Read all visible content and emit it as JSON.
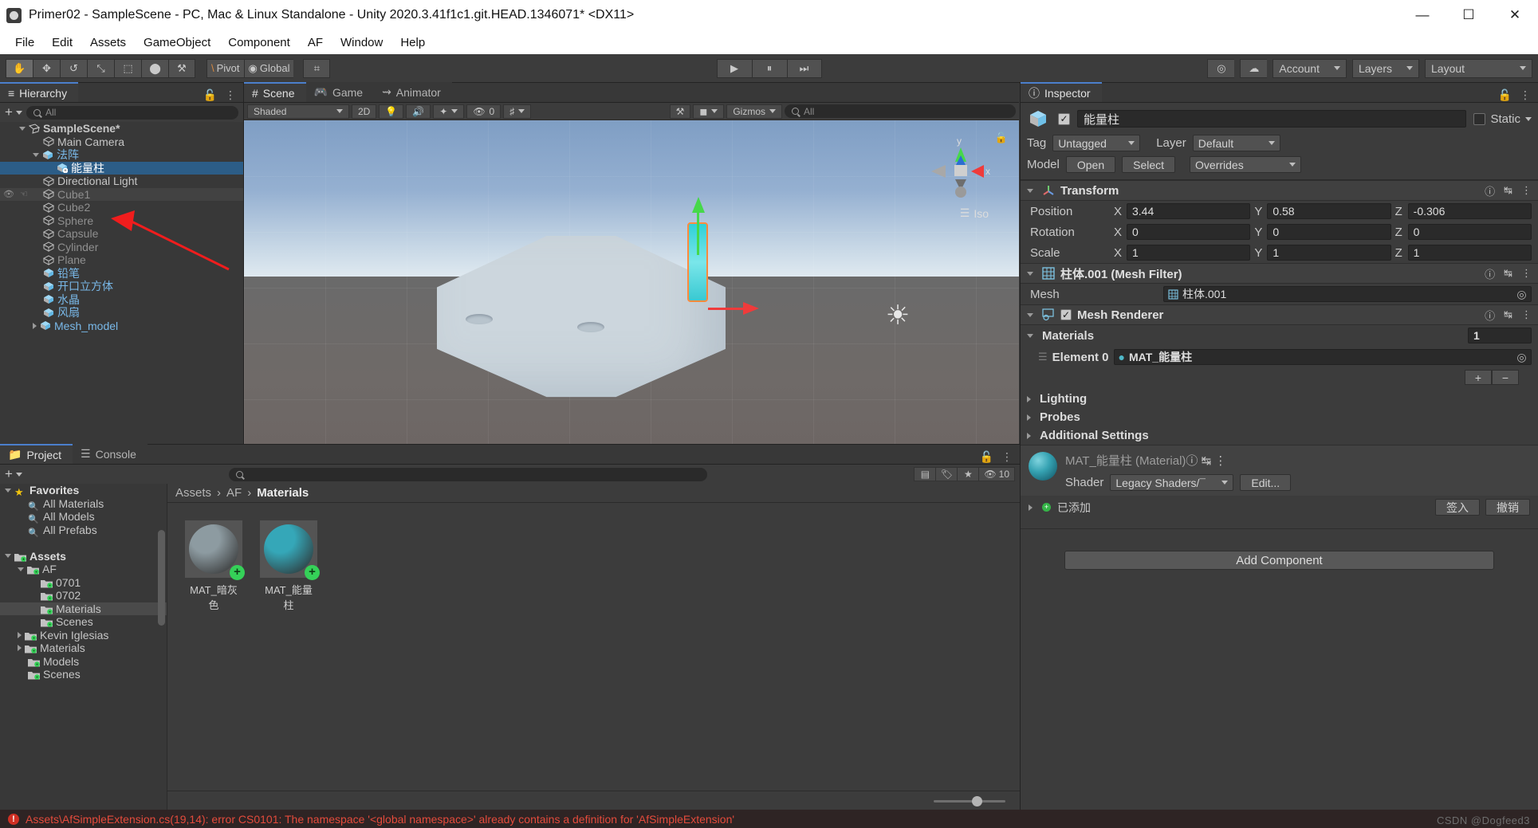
{
  "window": {
    "title": "Primer02 - SampleScene - PC, Mac & Linux Standalone - Unity 2020.3.41f1c1.git.HEAD.1346071* <DX11>",
    "minimize": "—",
    "maximize": "☐",
    "close": "✕"
  },
  "menubar": [
    "File",
    "Edit",
    "Assets",
    "GameObject",
    "Component",
    "AF",
    "Window",
    "Help"
  ],
  "toolbar": {
    "tools": [
      {
        "name": "hand-tool",
        "glyph": "✋"
      },
      {
        "name": "move-tool",
        "glyph": "✥"
      },
      {
        "name": "rotate-tool",
        "glyph": "↺"
      },
      {
        "name": "scale-tool",
        "glyph": "⤡"
      },
      {
        "name": "rect-tool",
        "glyph": "⬚"
      },
      {
        "name": "transform-tool",
        "glyph": "⬤"
      },
      {
        "name": "custom-tool",
        "glyph": "⚒"
      }
    ],
    "pivot_label": "Pivot",
    "global_label": "Global",
    "grid_glyph": "⌗",
    "play": "▶",
    "pause": "⏸",
    "step": "⏭",
    "collab_glyph": "☁",
    "services_glyph": "◎",
    "account": "Account",
    "layers": "Layers",
    "layout": "Layout"
  },
  "hierarchy": {
    "tab": "Hierarchy",
    "search_placeholder": "All",
    "items": [
      {
        "label": "SampleScene*",
        "depth": 0,
        "icon": "scene-icon",
        "arrow": "open",
        "bold": true,
        "state": "normal"
      },
      {
        "label": "Main Camera",
        "depth": 1,
        "icon": "gameobject-icon",
        "arrow": "none",
        "state": "normal"
      },
      {
        "label": "法阵",
        "depth": 1,
        "icon": "prefab-icon",
        "arrow": "open",
        "state": "prefab"
      },
      {
        "label": "能量柱",
        "depth": 2,
        "icon": "prefab-child-icon",
        "arrow": "none",
        "state": "selected"
      },
      {
        "label": "Directional Light",
        "depth": 1,
        "icon": "gameobject-icon",
        "arrow": "none",
        "state": "normal"
      },
      {
        "label": "Cube1",
        "depth": 1,
        "icon": "gameobject-icon",
        "arrow": "none",
        "state": "hidden-hover"
      },
      {
        "label": "Cube2",
        "depth": 1,
        "icon": "gameobject-icon",
        "arrow": "none",
        "state": "dim"
      },
      {
        "label": "Sphere",
        "depth": 1,
        "icon": "gameobject-icon",
        "arrow": "none",
        "state": "dim"
      },
      {
        "label": "Capsule",
        "depth": 1,
        "icon": "gameobject-icon",
        "arrow": "none",
        "state": "dim"
      },
      {
        "label": "Cylinder",
        "depth": 1,
        "icon": "gameobject-icon",
        "arrow": "none",
        "state": "dim"
      },
      {
        "label": "Plane",
        "depth": 1,
        "icon": "gameobject-icon",
        "arrow": "none",
        "state": "dim"
      },
      {
        "label": "铅笔",
        "depth": 1,
        "icon": "prefab-icon",
        "arrow": "none",
        "state": "prefab"
      },
      {
        "label": "开口立方体",
        "depth": 1,
        "icon": "prefab-icon",
        "arrow": "none",
        "state": "prefab"
      },
      {
        "label": "水晶",
        "depth": 1,
        "icon": "prefab-icon",
        "arrow": "none",
        "state": "prefab"
      },
      {
        "label": "风扇",
        "depth": 1,
        "icon": "prefab-icon",
        "arrow": "none",
        "state": "prefab"
      },
      {
        "label": "Mesh_model",
        "depth": 1,
        "icon": "prefab-icon",
        "arrow": "closed",
        "state": "prefab"
      }
    ]
  },
  "scene": {
    "tabs": [
      {
        "label": "Scene",
        "icon": "grid-icon",
        "active": true
      },
      {
        "label": "Game",
        "icon": "gamepad-icon",
        "active": false
      },
      {
        "label": "Animator",
        "icon": "animator-icon",
        "active": false
      }
    ],
    "shading": "Shaded",
    "mode_2d": "2D",
    "light_glyph": "Ὂ1",
    "audio_glyph": "ὐA",
    "fx_glyph": "✦",
    "hidden_count": "0",
    "grid_glyph": "⌗",
    "tool_glyph": "⚒",
    "camera_glyph": "■",
    "gizmos_label": "Gizmos",
    "gizmos_search_placeholder": "All",
    "view_mode": "Iso",
    "axis_x": "x",
    "axis_y": "y"
  },
  "inspector": {
    "tab": "Inspector",
    "object_name": "能量柱",
    "enabled": true,
    "static_label": "Static",
    "tag_label": "Tag",
    "tag_value": "Untagged",
    "layer_label": "Layer",
    "layer_value": "Default",
    "model_label": "Model",
    "open_button": "Open",
    "select_button": "Select",
    "overrides_button": "Overrides",
    "transform": {
      "title": "Transform",
      "rows": [
        {
          "name": "Position",
          "x": "3.44",
          "y": "0.58",
          "z": "-0.306"
        },
        {
          "name": "Rotation",
          "x": "0",
          "y": "0",
          "z": "0"
        },
        {
          "name": "Scale",
          "x": "1",
          "y": "1",
          "z": "1"
        }
      ]
    },
    "mesh_filter": {
      "title": "柱体.001 (Mesh Filter)",
      "mesh_label": "Mesh",
      "mesh_value": "柱体.001"
    },
    "mesh_renderer": {
      "title": "Mesh Renderer",
      "enabled": true,
      "materials_label": "Materials",
      "materials_count": "1",
      "element_label": "Element 0",
      "element_value": "MAT_能量柱",
      "plus": "+",
      "minus": "−",
      "sections": [
        "Lighting",
        "Probes",
        "Additional Settings"
      ]
    },
    "material_preview": {
      "title": "MAT_能量柱 (Material)",
      "shader_label": "Shader",
      "shader_value": "Legacy Shaders/¯",
      "edit_button": "Edit..."
    },
    "vcs": {
      "status": "已添加",
      "checkin_button": "签入",
      "revert_button": "撤销"
    },
    "add_component": "Add Component"
  },
  "project": {
    "tabs": [
      {
        "label": "Project",
        "icon": "folder-icon",
        "active": true
      },
      {
        "label": "Console",
        "icon": "console-icon",
        "active": false
      }
    ],
    "search_placeholder": "",
    "filter_icons": [
      "type-filter-icon",
      "label-filter-icon",
      "favorite-filter-icon"
    ],
    "hidden_count": "10",
    "tree": [
      {
        "label": "Favorites",
        "depth": 0,
        "icon": "star-icon",
        "arrow": "open",
        "bold": true
      },
      {
        "label": "All Materials",
        "depth": 1,
        "icon": "search-icon",
        "arrow": "none"
      },
      {
        "label": "All Models",
        "depth": 1,
        "icon": "search-icon",
        "arrow": "none"
      },
      {
        "label": "All Prefabs",
        "depth": 1,
        "icon": "search-icon",
        "arrow": "none"
      },
      {
        "label": "",
        "depth": 0,
        "icon": "spacer",
        "arrow": "none"
      },
      {
        "label": "Assets",
        "depth": 0,
        "icon": "folder-vcs-icon",
        "arrow": "open",
        "bold": true
      },
      {
        "label": "AF",
        "depth": 1,
        "icon": "folder-vcs-icon",
        "arrow": "open"
      },
      {
        "label": "0701",
        "depth": 2,
        "icon": "folder-vcs-icon",
        "arrow": "none"
      },
      {
        "label": "0702",
        "depth": 2,
        "icon": "folder-vcs-icon",
        "arrow": "none"
      },
      {
        "label": "Materials",
        "depth": 2,
        "icon": "folder-vcs-icon",
        "arrow": "none",
        "selected": true
      },
      {
        "label": "Scenes",
        "depth": 2,
        "icon": "folder-vcs-icon",
        "arrow": "none"
      },
      {
        "label": "Kevin Iglesias",
        "depth": 1,
        "icon": "folder-vcs-icon",
        "arrow": "closed"
      },
      {
        "label": "Materials",
        "depth": 1,
        "icon": "folder-vcs-icon",
        "arrow": "closed"
      },
      {
        "label": "Models",
        "depth": 1,
        "icon": "folder-vcs-icon",
        "arrow": "none"
      },
      {
        "label": "Scenes",
        "depth": 1,
        "icon": "folder-vcs-icon",
        "arrow": "none"
      }
    ],
    "breadcrumb": [
      "Assets",
      "AF",
      "Materials"
    ],
    "assets": [
      {
        "name": "MAT_暗灰色",
        "color": "#8d9ba1",
        "badge": "+"
      },
      {
        "name": "MAT_能量柱",
        "color": "#35a7b8",
        "badge": "+"
      }
    ]
  },
  "status": {
    "message": "Assets\\AfSimpleExtension.cs(19,14): error CS0101: The namespace '<global namespace>' already contains a definition for 'AfSimpleExtension'",
    "error_icon": "!",
    "watermark": "CSDN @Dogfeed3"
  },
  "colors": {
    "accent_blue": "#4b7fcc",
    "selection_blue": "#2c5d87",
    "error_red": "#e44b3c",
    "prefab_blue": "#79b8e8",
    "gizmo_green": "#46d84a",
    "gizmo_red": "#ef3b3b",
    "highlight_orange": "#ff8a3c"
  }
}
